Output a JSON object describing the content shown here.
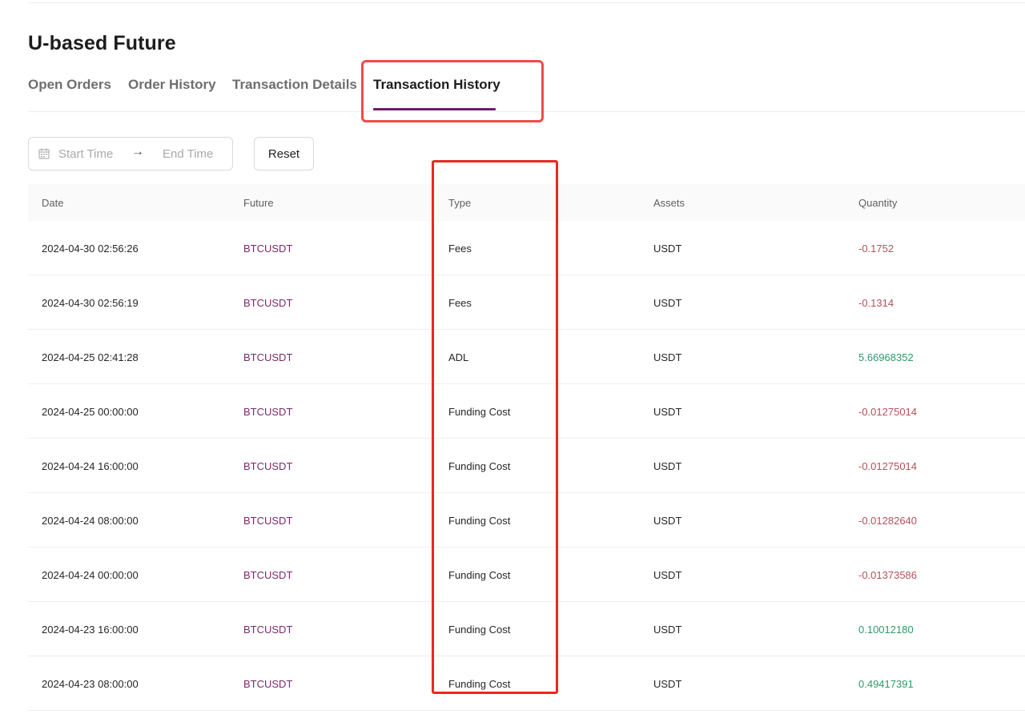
{
  "page": {
    "title": "U-based Future"
  },
  "tabs": [
    {
      "label": "Open Orders",
      "active": false
    },
    {
      "label": "Order History",
      "active": false
    },
    {
      "label": "Transaction Details",
      "active": false
    },
    {
      "label": "Transaction History",
      "active": true
    }
  ],
  "filters": {
    "start_placeholder": "Start Time",
    "end_placeholder": "End Time",
    "reset_label": "Reset",
    "calendar_icon": "calendar-icon",
    "arrow_icon": "arrow-right-icon"
  },
  "table": {
    "headers": [
      "Date",
      "Future",
      "Type",
      "Assets",
      "Quantity"
    ],
    "rows": [
      {
        "date": "2024-04-30 02:56:26",
        "future": "BTCUSDT",
        "type": "Fees",
        "assets": "USDT",
        "quantity": "-0.1752"
      },
      {
        "date": "2024-04-30 02:56:19",
        "future": "BTCUSDT",
        "type": "Fees",
        "assets": "USDT",
        "quantity": "-0.1314"
      },
      {
        "date": "2024-04-25 02:41:28",
        "future": "BTCUSDT",
        "type": "ADL",
        "assets": "USDT",
        "quantity": "5.66968352"
      },
      {
        "date": "2024-04-25 00:00:00",
        "future": "BTCUSDT",
        "type": "Funding Cost",
        "assets": "USDT",
        "quantity": "-0.01275014"
      },
      {
        "date": "2024-04-24 16:00:00",
        "future": "BTCUSDT",
        "type": "Funding Cost",
        "assets": "USDT",
        "quantity": "-0.01275014"
      },
      {
        "date": "2024-04-24 08:00:00",
        "future": "BTCUSDT",
        "type": "Funding Cost",
        "assets": "USDT",
        "quantity": "-0.01282640"
      },
      {
        "date": "2024-04-24 00:00:00",
        "future": "BTCUSDT",
        "type": "Funding Cost",
        "assets": "USDT",
        "quantity": "-0.01373586"
      },
      {
        "date": "2024-04-23 16:00:00",
        "future": "BTCUSDT",
        "type": "Funding Cost",
        "assets": "USDT",
        "quantity": "0.10012180"
      },
      {
        "date": "2024-04-23 08:00:00",
        "future": "BTCUSDT",
        "type": "Funding Cost",
        "assets": "USDT",
        "quantity": "0.49417391"
      }
    ]
  },
  "colors": {
    "accent": "#6f1a6c",
    "negative": "#b5505a",
    "positive": "#2e9a6a",
    "highlight_box": "#e8291f"
  }
}
